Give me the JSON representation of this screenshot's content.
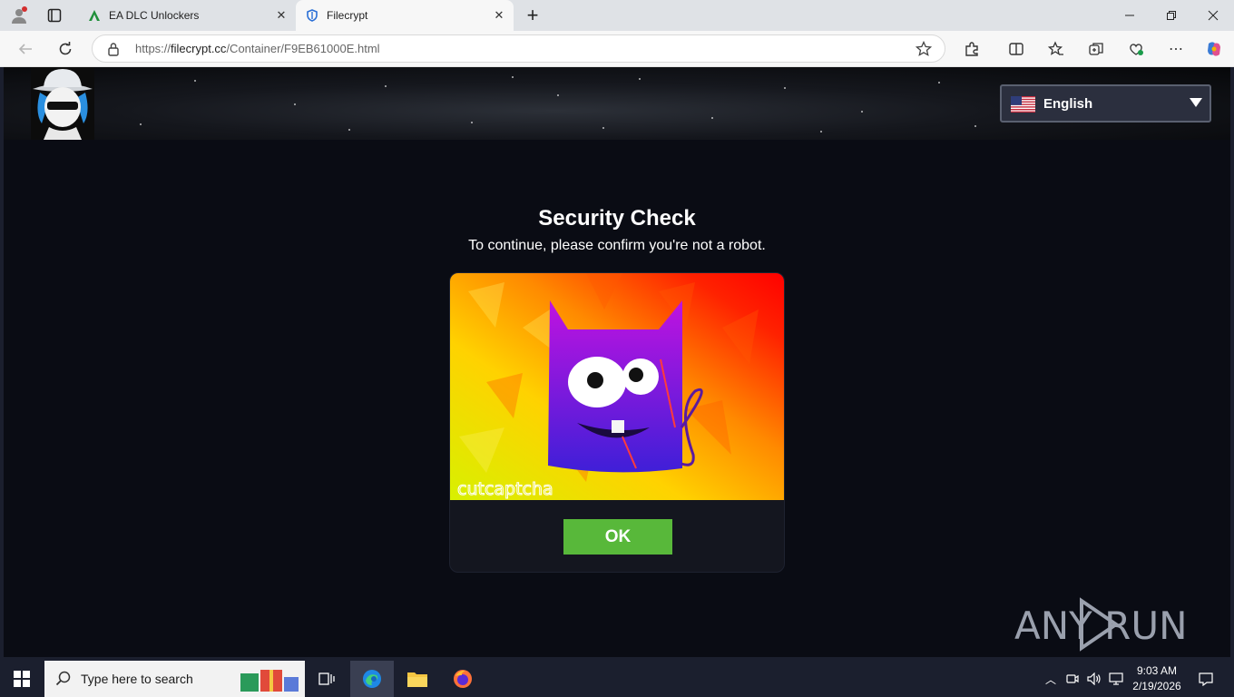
{
  "browser": {
    "tabs": [
      {
        "title": "EA DLC Unlockers",
        "favicon": "green-a-icon"
      },
      {
        "title": "Filecrypt",
        "favicon": "shield-icon",
        "active": true
      }
    ],
    "new_tab_label": "+",
    "url_prefix": "https://",
    "url_domain": "filecrypt.cc",
    "url_path": "/Container/F9EB61000E.html"
  },
  "page": {
    "language": "English",
    "title": "Security Check",
    "subtitle": "To continue, please confirm you're not a robot.",
    "captcha_brand": "cutcaptcha",
    "ok_label": "OK",
    "watermark": "ANY RUN"
  },
  "taskbar": {
    "search_placeholder": "Type here to search",
    "time": "9:03 AM",
    "date": "2/19/2026"
  },
  "colors": {
    "ok_button": "#58b83a",
    "page_bg": "#0a0c14",
    "taskbar_bg": "#1b1f2e"
  }
}
